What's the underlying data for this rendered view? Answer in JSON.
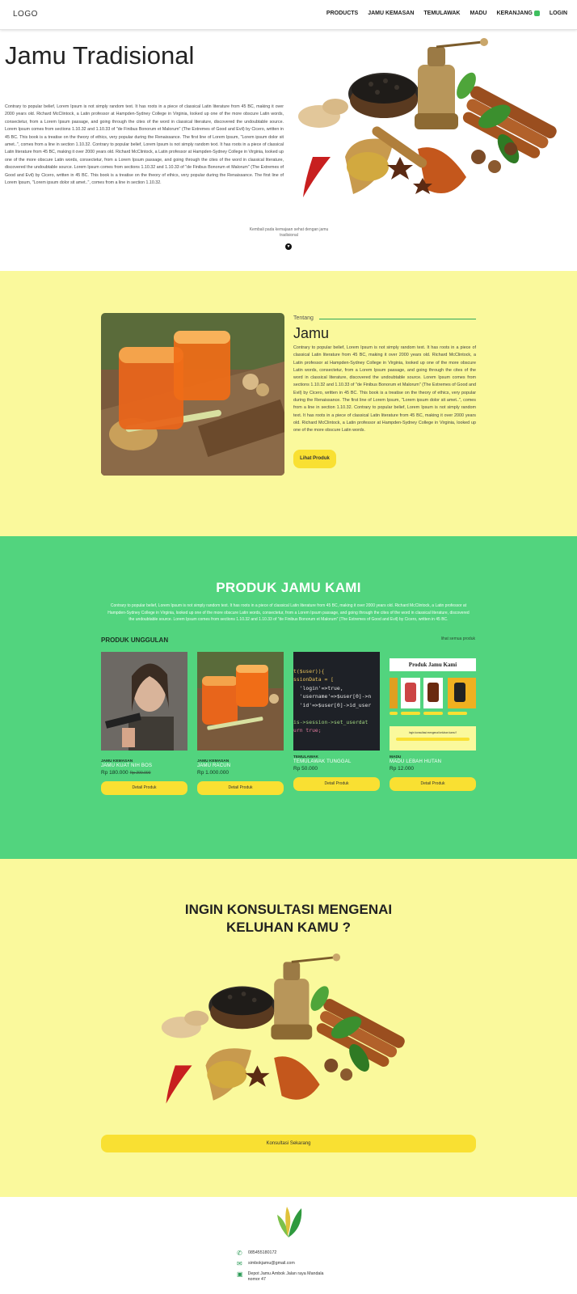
{
  "nav": {
    "logo": "LOGO",
    "items": [
      "PRODUCTS",
      "JAMU KEMASAN",
      "TEMULAWAK",
      "MADU",
      "KERANJANG",
      "LOGIN"
    ]
  },
  "hero": {
    "title": "Jamu Tradisional",
    "text": "Contrary to popular belief, Lorem Ipsum is not simply random text. It has roots in a piece of classical Latin literature from 45 BC, making it over 2000 years old. Richard McClintock, a Latin professor at Hampden-Sydney College in Virginia, looked up one of the more obscure Latin words, consectetur, from a Lorem Ipsum passage, and going through the cites of the word in classical literature, discovered the undoubtable source. Lorem Ipsum comes from sections 1.10.32 and 1.10.33 of \"de Finibus Bonorum et Malorum\" (The Extremes of Good and Evil) by Cicero, written in 45 BC. This book is a treatise on the theory of ethics, very popular during the Renaissance. The first line of Lorem Ipsum, \"Lorem ipsum dolor sit amet..\", comes from a line in section 1.10.32. Contrary to popular belief, Lorem Ipsum is not simply random text. It has roots in a piece of classical Latin literature from 45 BC, making it over 2000 years old. Richard McClintock, a Latin professor at Hampden-Sydney College in Virginia, looked up one of the more obscure Latin words, consectetur, from a Lorem Ipsum passage, and going through the cites of the word in classical literature, discovered the undoubtable source. Lorem Ipsum comes from sections 1.10.32 and 1.10.33 of \"de Finibus Bonorum et Malorum\" (The Extremes of Good and Evil) by Cicero, written in 45 BC. This book is a treatise on the theory of ethics, very popular during the Renaissance. The first line of Lorem Ipsum, \"Lorem ipsum dolor sit amet..\", comes from a line in section 1.10.32.",
    "scroll_hint": "Kembali pada kemajaan sehat dengan jamu tradisional"
  },
  "about": {
    "label": "Tentang",
    "title": "Jamu",
    "text": "Contrary to popular belief, Lorem Ipsum is not simply random text. It has roots in a piece of classical Latin literature from 45 BC, making it over 2000 years old. Richard McClintock, a Latin professor at Hampden-Sydney College in Virginia, looked up one of the more obscure Latin words, consectetur, from a Lorem Ipsum passage, and going through the cites of the word in classical literature, discovered the undoubtable source. Lorem Ipsum comes from sections 1.10.32 and 1.10.33 of \"de Finibus Bonorum et Malorum\" (The Extremes of Good and Evil) by Cicero, written in 45 BC. This book is a treatise on the theory of ethics, very popular during the Renaissance. The first line of Lorem Ipsum, \"Lorem ipsum dolor sit amet..\", comes from a line in section 1.10.32. Contrary to popular belief, Lorem Ipsum is not simply random text. It has roots in a piece of classical Latin literature from 45 BC, making it over 2000 years old. Richard McClintock, a Latin professor at Hampden-Sydney College in Virginia, looked up one of the more obscure Latin words.",
    "button": "Lihat Produk"
  },
  "products": {
    "title": "PRODUK JAMU KAMI",
    "desc": "Contrary to popular belief, Lorem Ipsum is not simply random text. It has roots in a piece of classical Latin literature from 45 BC, making it over 2000 years old. Richard McClintock, a Latin professor at Hampden-Sydney College in Virginia, looked up one of the more obscure Latin words, consectetur, from a Lorem Ipsum passage, and going through the cites of the word in classical literature, discovered the undoubtable source. Lorem Ipsum comes from sections 1.10.32 and 1.10.33 of \"de Finibus Bonorum et Malorum\" (The Extremes of Good and Evil) by Cicero, written in 45 BC.",
    "section": "PRODUK UNGGULAN",
    "see_all": "lihat semua produk",
    "cards": [
      {
        "category": "JAMU KEMASAN",
        "name": "JAMU KUAT NIH BOS",
        "price": "Rp 180.000",
        "old_price": "Rp 200.000",
        "button": "Detail Produk"
      },
      {
        "category": "JAMU KEMASAN",
        "name": "JAMU RACUN",
        "price": "Rp 1.000.000",
        "old_price": "",
        "button": "Detail Produk"
      },
      {
        "category": "TEMULAWAK",
        "name": "TEMULAWAK TUNGGAL",
        "price": "Rp 50.000",
        "old_price": "",
        "button": "Detail Produk"
      },
      {
        "category": "MADU",
        "name": "MADU LEBAH HUTAN",
        "price": "Rp 12.000",
        "old_price": "",
        "button": "Detail Produk"
      }
    ],
    "code_lines": [
      "t($user)){",
      "ssionData = [",
      "  'login'=>true,",
      "  'username'=>$user[0]->n",
      "  'id'=>$user[0]->id_user",
      "",
      "is->session->set_userdat",
      "urn true;"
    ],
    "shop_title": "Produk Jamu Kami",
    "shop_caption": "Ingin konsultasi mengenai keluhan kamu?"
  },
  "consult": {
    "title": "INGIN KONSULTASI MENGENAI KELUHAN KAMU ?",
    "button": "Konsultasi Sekarang"
  },
  "footer": {
    "phone": "085455180172",
    "email": "simbokjamu@gmail.com",
    "address": "Depot Jamu Ambok Jalan raya Mandala nomor 47"
  },
  "colors": {
    "yellow_bg": "#faf99c",
    "green_bg": "#52d47e",
    "button_yellow": "#f9e032",
    "accent_green": "#3fbf5f"
  }
}
